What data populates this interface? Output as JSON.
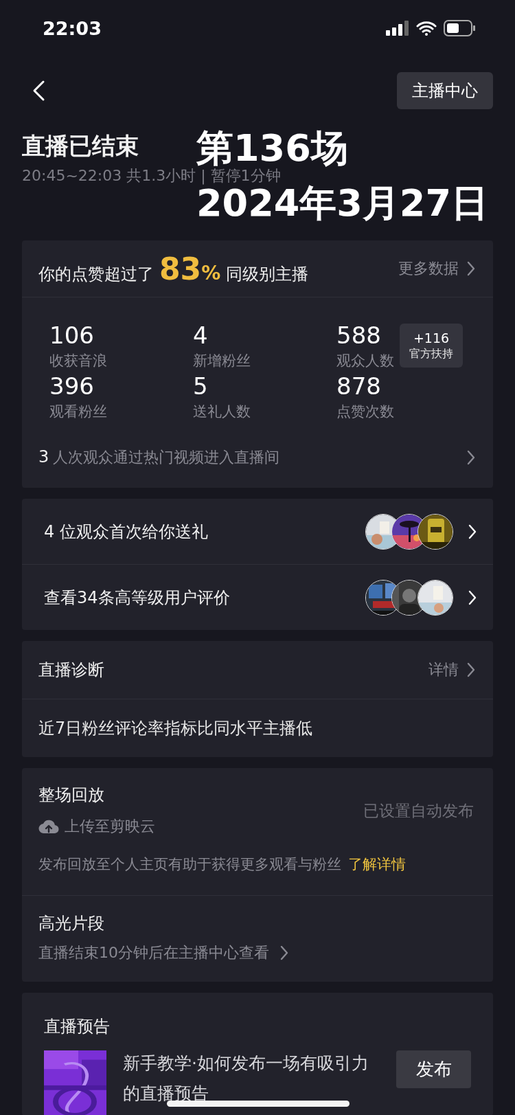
{
  "status_bar": {
    "time": "22:03"
  },
  "nav": {
    "action_button": "主播中心"
  },
  "header": {
    "title": "直播已结束",
    "subtitle": "20:45~22:03 共1.3小时 | 暂停1分钟"
  },
  "overlay": {
    "lines": [
      "第136场",
      "2024年3月27日"
    ]
  },
  "summary": {
    "prefix": "你的点赞超过了",
    "value": "83",
    "unit": "%",
    "suffix": "同级别主播",
    "link": "更多数据",
    "stats": [
      {
        "value": "106",
        "label": "收获音浪"
      },
      {
        "value": "4",
        "label": "新增粉丝"
      },
      {
        "value": "588",
        "label": "观众人数",
        "badge": {
          "value": "+116",
          "label": "官方扶持"
        }
      },
      {
        "value": "396",
        "label": "观看粉丝"
      },
      {
        "value": "5",
        "label": "送礼人数"
      },
      {
        "value": "878",
        "label": "点赞次数"
      }
    ],
    "footer": {
      "count": "3",
      "text": "人次观众通过热门视频进入直播间"
    }
  },
  "audience_rows": [
    {
      "text": "4 位观众首次给你送礼"
    },
    {
      "text": "查看34条高等级用户评价"
    }
  ],
  "diagnosis": {
    "title": "直播诊断",
    "link": "详情",
    "text": "近7日粉丝评论率指标比同水平主播低"
  },
  "replay": {
    "title": "整场回放",
    "upload": "上传至剪映云",
    "status": "已设置自动发布",
    "description": "发布回放至个人主页有助于获得更多观看与粉丝",
    "link": "了解详情",
    "highlights": {
      "title": "高光片段",
      "text": "直播结束10分钟后在主播中心查看"
    }
  },
  "preview": {
    "title": "直播预告",
    "text": "新手教学·如何发布一场有吸引力的直播预告",
    "button": "发布"
  }
}
